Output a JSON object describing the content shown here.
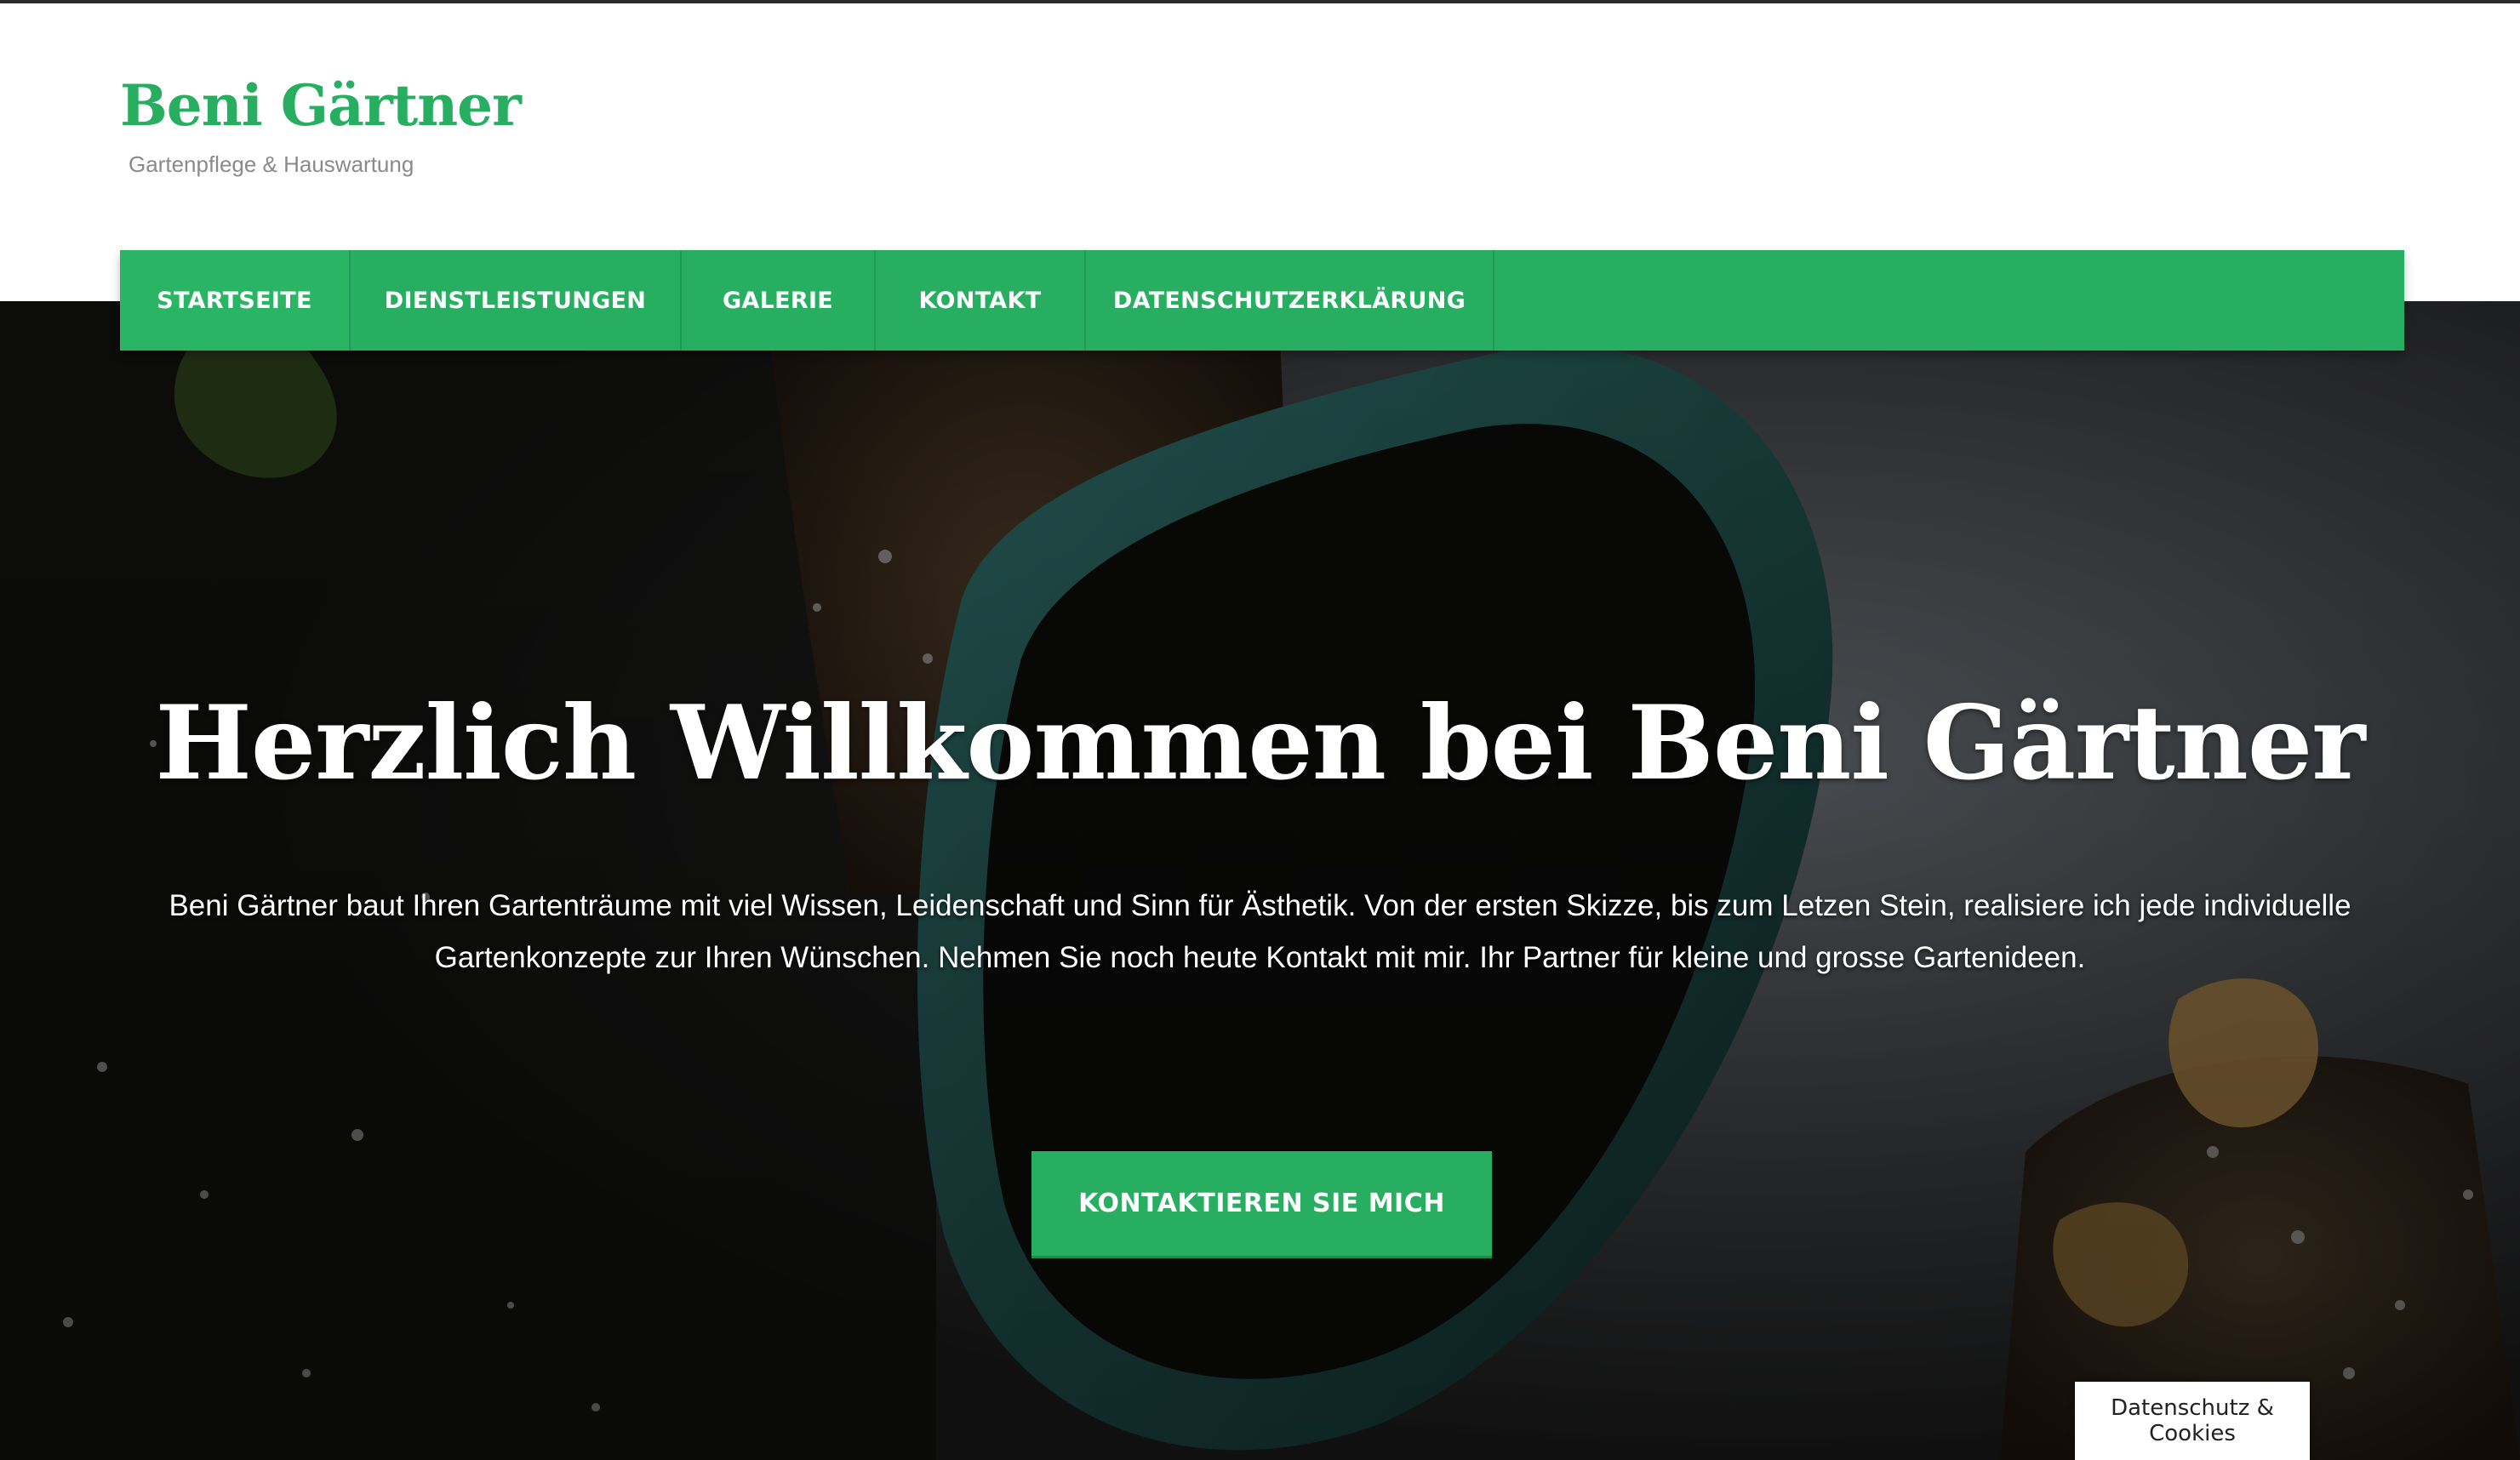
{
  "header": {
    "site_title": "Beni Gärtner",
    "tagline": "Gartenpflege & Hauswartung"
  },
  "nav": {
    "items": [
      {
        "label": "STARTSEITE",
        "active": true
      },
      {
        "label": "DIENSTLEISTUNGEN",
        "active": false
      },
      {
        "label": "GALERIE",
        "active": false
      },
      {
        "label": "KONTAKT",
        "active": false
      },
      {
        "label": "DATENSCHUTZERKLÄRUNG",
        "active": false
      }
    ]
  },
  "hero": {
    "heading": "Herzlich Willkommen bei Beni Gärtner",
    "text": "Beni Gärtner baut Ihren Gartenträume mit viel Wissen, Leidenschaft und Sinn für Ästhetik. Von der ersten Skizze, bis zum Letzen Stein, realisiere ich jede individuelle Gartenkonzepte zur Ihren Wünschen. Nehmen Sie noch heute Kontakt mit mir. Ihr Partner für kleine und grosse Gartenideen.",
    "cta_label": "KONTAKTIEREN SIE MICH"
  },
  "cookie": {
    "label": "Datenschutz & Cookies"
  },
  "colors": {
    "accent": "#27ae60",
    "tagline": "#8a8a8a",
    "hero_text": "#ffffff"
  }
}
